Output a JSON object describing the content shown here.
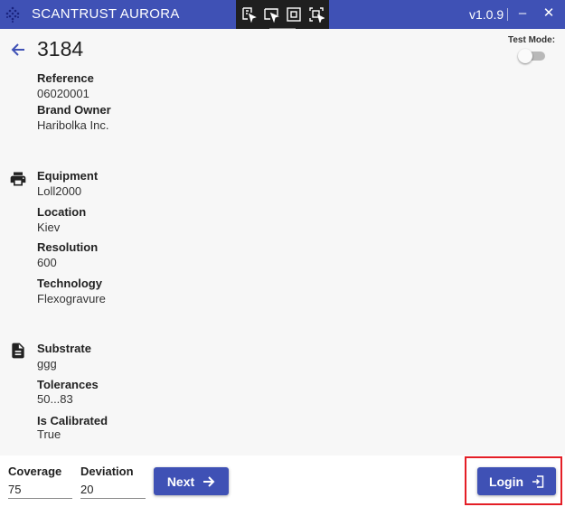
{
  "window": {
    "title": "SCANTRUST AURORA",
    "version": "v1.0.9",
    "logo_icon": "scantrust-logo-icon",
    "minimize_label": "–",
    "close_label": "✕"
  },
  "snip_toolbar": {
    "tools": [
      "freeform-snip-icon",
      "window-snip-icon",
      "fullscreen-snip-icon",
      "rectangle-snip-icon"
    ]
  },
  "page": {
    "title": "3184",
    "back_icon": "arrow-left-icon",
    "test_mode": {
      "label": "Test Mode:",
      "enabled": false
    }
  },
  "sections": [
    {
      "icon": null,
      "fields": [
        {
          "label": "Reference",
          "value": "06020001"
        },
        {
          "label": "Brand Owner",
          "value": "Haribolka Inc."
        }
      ]
    },
    {
      "icon": "printer-icon",
      "fields": [
        {
          "label": "Equipment",
          "value": "Loll2000"
        },
        {
          "label": "Location",
          "value": "Kiev"
        },
        {
          "label": "Resolution",
          "value": "600"
        },
        {
          "label": "Technology",
          "value": "Flexogravure"
        }
      ]
    },
    {
      "icon": "document-icon",
      "fields": [
        {
          "label": "Substrate",
          "value": "ggg"
        },
        {
          "label": "Tolerances",
          "value": "50...83"
        },
        {
          "label": "Is Calibrated",
          "value": "True"
        }
      ]
    }
  ],
  "bottom": {
    "coverage": {
      "label": "Coverage",
      "value": "75"
    },
    "deviation": {
      "label": "Deviation",
      "value": "20"
    },
    "next_label": "Next",
    "login_label": "Login"
  },
  "colors": {
    "primary": "#3f51b5",
    "highlight": "#e41e26"
  }
}
